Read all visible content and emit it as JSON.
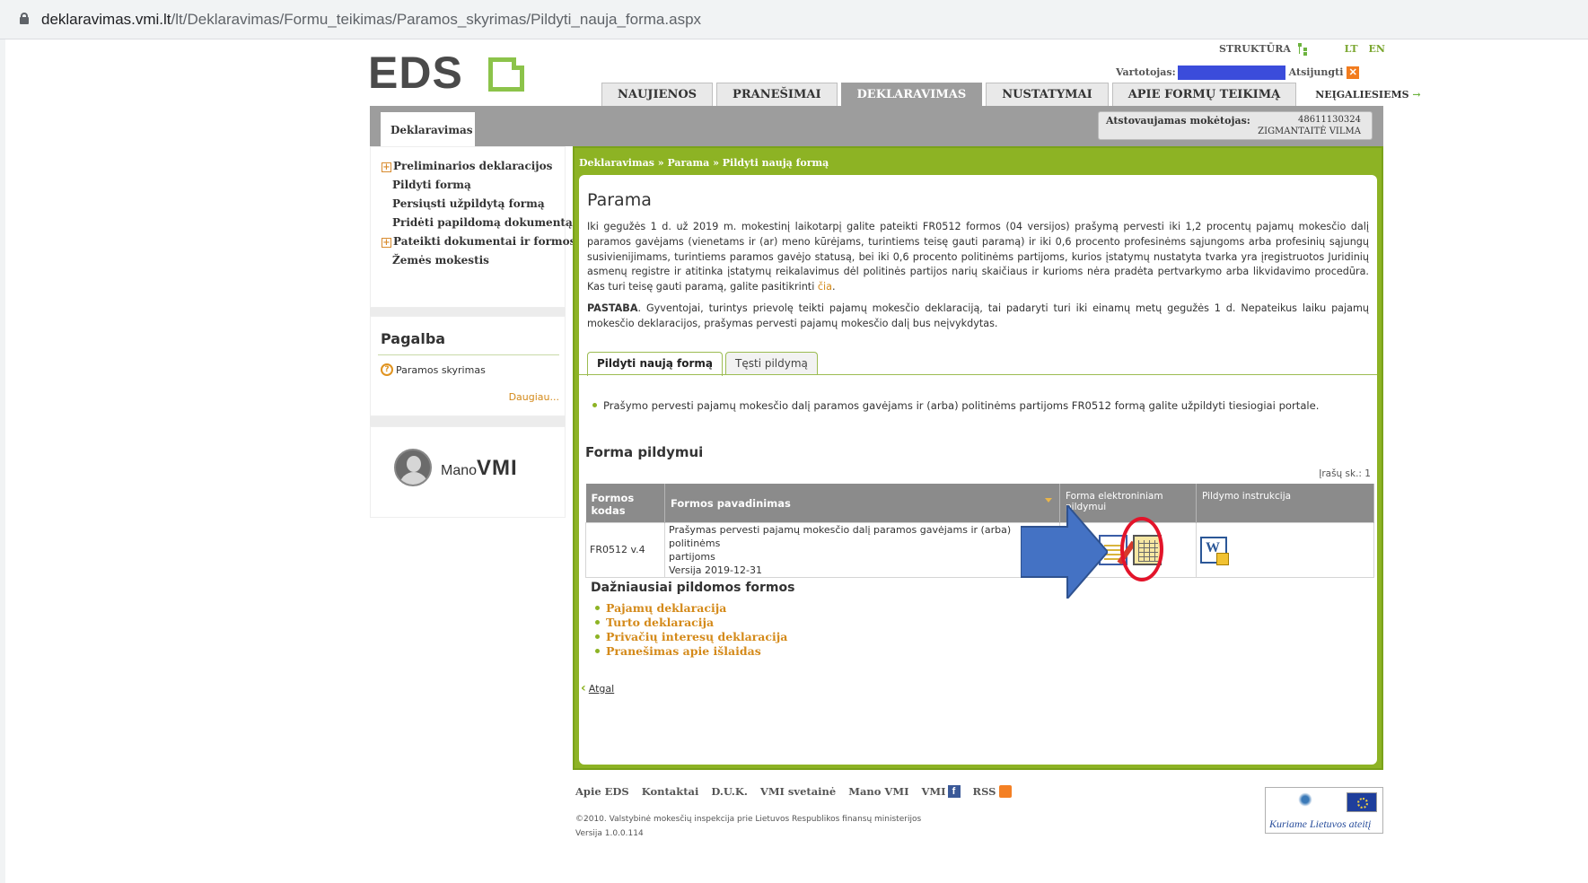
{
  "browser": {
    "url_host": "deklaravimas.vmi.lt",
    "url_path": "/lt/Deklaravimas/Formu_teikimas/Paramos_skyrimas/Pildyti_nauja_forma.aspx"
  },
  "header": {
    "logo_text": "EDS",
    "struktura": "STRUKTŪRA",
    "lang_lt": "LT",
    "lang_en": "EN",
    "user_label": "Vartotojas:",
    "logout": "Atsijungti",
    "tabs": [
      {
        "label": "NAUJIENOS"
      },
      {
        "label": "PRANEŠIMAI"
      },
      {
        "label": "DEKLARAVIMAS"
      },
      {
        "label": "NUSTATYMAI"
      },
      {
        "label": "APIE FORMŲ TEIKIMĄ"
      }
    ],
    "accessibility": "NEĮGALIESIEMS",
    "arrow": "→",
    "subtab": "Deklaravimas",
    "payer_label": "Atstovaujamas mokėtojas:",
    "payer_number": "48611130324",
    "payer_name": "ZIGMANTAITĖ VILMA"
  },
  "sidebar": {
    "items": [
      {
        "label": "Preliminarios deklaracijos",
        "expander": "+"
      },
      {
        "label": "Pildyti formą"
      },
      {
        "label": "Persiųsti užpildytą formą"
      },
      {
        "label": "Pridėti papildomą dokumentą"
      },
      {
        "label": "Pateikti dokumentai ir formos",
        "expander": "+"
      },
      {
        "label": "Žemės mokestis"
      }
    ],
    "help_title": "Pagalba",
    "help_icon": "?",
    "help_link": "Paramos skyrimas",
    "help_more": "Daugiau...",
    "mano_prefix": "Mano",
    "mano_brand": "VMI"
  },
  "main": {
    "breadcrumb": "Deklaravimas » Parama » Pildyti naują formą",
    "title": "Parama",
    "intro": "Iki gegužės 1 d. už 2019 m. mokestinį laikotarpį galite pateikti FR0512 formos (04 versijos) prašymą pervesti iki 1,2 procentų pajamų mokesčio dalį paramos gavėjams (vienetams ir (ar) meno kūrėjams, turintiems teisę gauti paramą) ir iki 0,6 procento profesinėms sąjungoms arba profesinių sąjungų susivienijimams, turintiems paramos gavėjo statusą, bei iki 0,6 procento politinėms partijoms, kurios įstatymų nustatyta tvarka yra įregistruotos Juridinių asmenų registre ir atitinka įstatymų reikalavimus dėl politinės partijos narių skaičiaus ir kurioms nėra pradėta pertvarkymo arba likvidavimo procedūra. Kas turi teisę gauti paramą, galite pasitikrinti ",
    "intro_link": "čia",
    "intro_end": ".",
    "note_label": "PASTABA",
    "note_text": ". Gyventojai, turintys prievolę teikti pajamų mokesčio deklaraciją, tai padaryti turi iki einamų metų gegužės 1 d. Nepateikus laiku pajamų mokesčio deklaracijos, prašymas pervesti pajamų mokesčio dalį bus neįvykdytas.",
    "tabs": [
      {
        "label": "Pildyti naują formą"
      },
      {
        "label": "Tęsti pildymą"
      }
    ],
    "bullet": "Prašymo pervesti pajamų mokesčio dalį paramos gavėjams ir (arba) politinėms partijoms FR0512 formą galite užpildyti tiesiogiai portale.",
    "forms_title": "Forma pildymui",
    "record_count": "Įrašų sk.: 1",
    "table": {
      "headers": [
        "Formos kodas",
        "Formos pavadinimas",
        "Forma elektroniniam pildymui",
        "Pildymo instrukcija"
      ],
      "rows": [
        {
          "code": "FR0512 v.4",
          "name_line1": "Prašymas pervesti pajamų mokesčio dalį paramos gavėjams ir (arba) politinėms",
          "name_line2": "partijoms",
          "version": "Versija 2019-12-31"
        }
      ]
    },
    "freq_title": "Dažniausiai pildomos formos",
    "freq_links": [
      {
        "label": "Pajamų deklaracija"
      },
      {
        "label": "Turto deklaracija"
      },
      {
        "label": "Privačių interesų deklaracija"
      },
      {
        "label": "Pranešimas apie išlaidas"
      }
    ],
    "back": "Atgal",
    "back_chevron": "‹"
  },
  "footer": {
    "links": [
      {
        "label": "Apie EDS"
      },
      {
        "label": "Kontaktai"
      },
      {
        "label": "D.U.K."
      },
      {
        "label": "VMI svetainė"
      },
      {
        "label": "Mano VMI"
      },
      {
        "label": "VMI"
      },
      {
        "label": "RSS"
      }
    ],
    "facebook_glyph": "f",
    "copyright": "©2010. Valstybinė mokesčių inspekcija prie Lietuvos Respublikos finansų ministerijos",
    "version": "Versija 1.0.0.114",
    "eu_slogan": "Kuriame Lietuvos ateitį"
  },
  "colors": {
    "green": "#8db324",
    "orange_link": "#d48a1a",
    "annotation_arrow": "#4472c4",
    "annotation_ring": "#e3142a"
  }
}
